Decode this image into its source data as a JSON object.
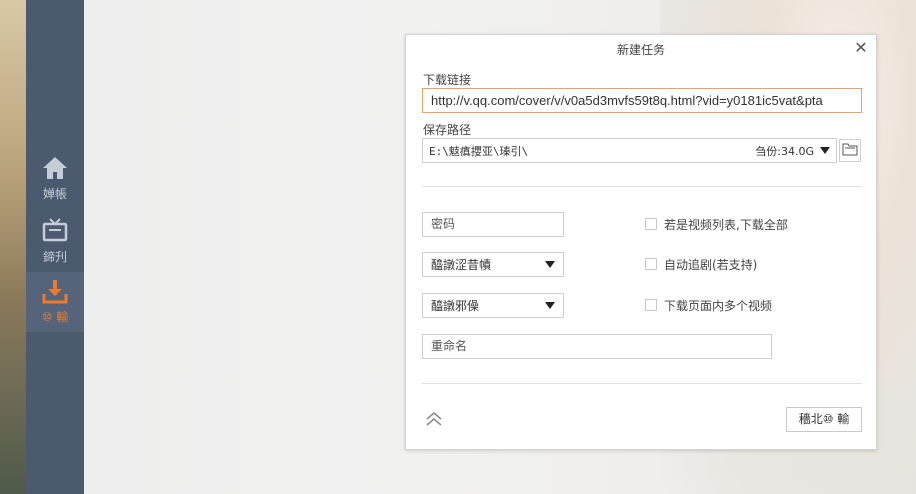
{
  "sidebar": {
    "items": [
      {
        "label": "婵帳",
        "icon": "home-icon"
      },
      {
        "label": "鍗刋",
        "icon": "tv-icon"
      },
      {
        "label": "⑩ 輸",
        "icon": "download-icon",
        "active": true
      }
    ]
  },
  "dialog": {
    "title": "新建任务",
    "url_label": "下载链接",
    "url_value": "http://v.qq.com/cover/v/v0a5d3mvfs59t8q.html?vid=y0181ic5vat&pta",
    "path_label": "保存路径",
    "path_value": "E:\\鬾瘨攖亚\\瑧引\\",
    "space_text": "刍份:34.0G",
    "password_placeholder": "密码",
    "select1_value": "醯譈涩昔幘",
    "select2_value": "醯譈邪僺",
    "rename_placeholder": "重命名",
    "checkboxes": [
      {
        "label": "若是视频列表,下载全部",
        "checked": false
      },
      {
        "label": "自动追剧(若支持)",
        "checked": false
      },
      {
        "label": "下载页面内多个视频",
        "checked": false
      }
    ],
    "start_label": "穡北⑩ 輸"
  },
  "colors": {
    "sidebar_bg": "#4b5a6e",
    "active_accent": "#f07a2a",
    "input_focus_border": "#f0a060"
  }
}
